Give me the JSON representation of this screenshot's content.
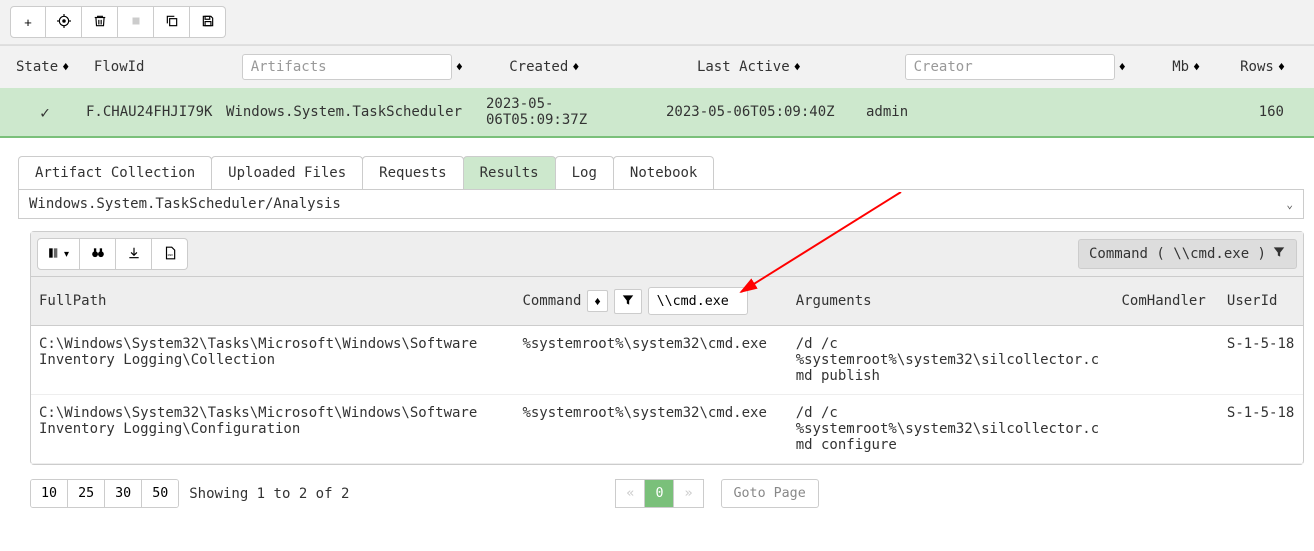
{
  "flows_header": {
    "state": "State",
    "flowid": "FlowId",
    "artifacts_placeholder": "Artifacts",
    "created": "Created",
    "last_active": "Last Active",
    "creator_placeholder": "Creator",
    "mb": "Mb",
    "rows": "Rows"
  },
  "flow_row": {
    "flowid": "F.CHAU24FHJI79K",
    "artifact": "Windows.System.TaskScheduler",
    "created": "2023-05-06T05:09:37Z",
    "last_active": "2023-05-06T05:09:40Z",
    "creator": "admin",
    "mb": "",
    "rows": "160"
  },
  "tabs": {
    "artifact_collection": "Artifact Collection",
    "uploaded_files": "Uploaded Files",
    "requests": "Requests",
    "results": "Results",
    "log": "Log",
    "notebook": "Notebook"
  },
  "analysis_path": "Windows.System.TaskScheduler/Analysis",
  "filter_chip": "Command ( \\\\cmd.exe )",
  "table": {
    "headers": {
      "fullpath": "FullPath",
      "command": "Command",
      "arguments": "Arguments",
      "comhandler": "ComHandler",
      "userid": "UserId"
    },
    "filter_value": "\\\\cmd.exe",
    "rows": [
      {
        "fullpath": "C:\\Windows\\System32\\Tasks\\Microsoft\\Windows\\Software Inventory Logging\\Collection",
        "command": "%systemroot%\\system32\\cmd.exe",
        "arguments": "/d /c %systemroot%\\system32\\silcollector.cmd publish",
        "comhandler": "",
        "userid": "S-1-5-18"
      },
      {
        "fullpath": "C:\\Windows\\System32\\Tasks\\Microsoft\\Windows\\Software Inventory Logging\\Configuration",
        "command": "%systemroot%\\system32\\cmd.exe",
        "arguments": "/d /c %systemroot%\\system32\\silcollector.cmd configure",
        "comhandler": "",
        "userid": "S-1-5-18"
      }
    ]
  },
  "pagination": {
    "sizes": [
      "10",
      "25",
      "30",
      "50"
    ],
    "showing": "Showing 1 to 2 of 2",
    "current": "0",
    "goto": "Goto Page"
  }
}
